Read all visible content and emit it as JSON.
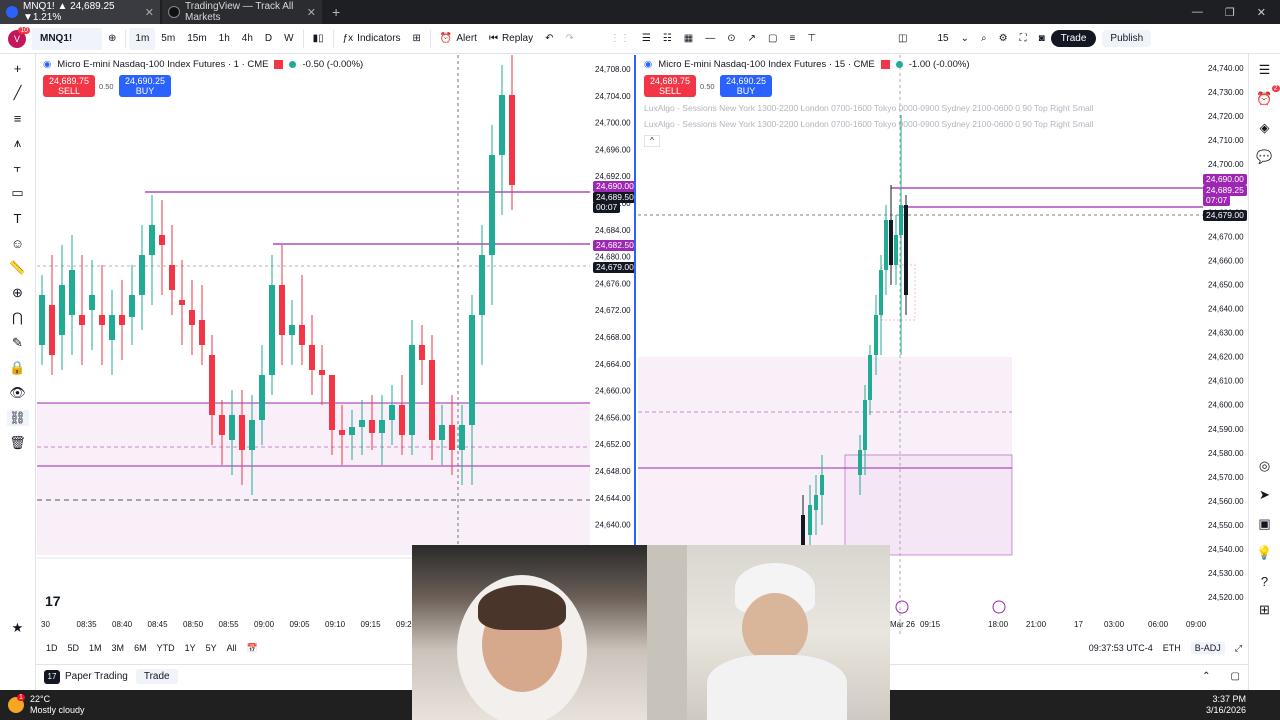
{
  "browser": {
    "tabs": [
      {
        "label": "MNQ1! ▲ 24,689.25 ▼1.21%",
        "active": true
      },
      {
        "label": "TradingView — Track All Markets",
        "active": false
      }
    ],
    "new_tab": "+"
  },
  "toolbar": {
    "symbol": "MNQ1!",
    "avatar_badge": "10",
    "intervals": [
      "1m",
      "5m",
      "15m",
      "1h",
      "4h",
      "D",
      "W"
    ],
    "active_interval": "1m",
    "indicators_label": "Indicators",
    "alert_label": "Alert",
    "replay_label": "Replay",
    "layout_count": "15",
    "trade_label": "Trade",
    "publish_label": "Publish"
  },
  "left_chart": {
    "legend_title": "Micro E-mini Nasdaq-100 Index Futures · 1 · CME",
    "legend_change": "-0.50 (-0.00%)",
    "sell_price": "24,689.75",
    "sell_label": "SELL",
    "spread": "0.50",
    "buy_price": "24,690.25",
    "buy_label": "BUY",
    "price_ticks": [
      "24,708.00",
      "24,704.00",
      "24,700.00",
      "24,696.00",
      "24,692.00",
      "24,688.00",
      "24,684.00",
      "24,680.00",
      "24,676.00",
      "24,672.00",
      "24,668.00",
      "24,664.00",
      "24,660.00",
      "24,656.00",
      "24,652.00",
      "24,648.00",
      "24,644.00",
      "24,640.00"
    ],
    "tag_line1": "24,690.00",
    "tag_current": "24,689.50",
    "tag_countdown": "00:07",
    "tag_line2": "24,682.50",
    "tag_cross": "24,679.00",
    "time_ticks": [
      "30",
      "08:35",
      "08:40",
      "08:45",
      "08:50",
      "08:55",
      "09:00",
      "09:05",
      "09:10",
      "09:15",
      "09:20"
    ]
  },
  "right_chart": {
    "legend_title": "Micro E-mini Nasdaq-100 Index Futures · 15 · CME",
    "legend_change": "-1.00 (-0.00%)",
    "sell_price": "24,689.75",
    "sell_label": "SELL",
    "spread": "0.50",
    "buy_price": "24,690.25",
    "buy_label": "BUY",
    "session_line1": "LuxAlgo - Sessions New York 1300-2200 London 0700-1600 Tokyo 0000-0900 Sydney 2100-0600 0 90 Top Right Small",
    "session_line2": "LuxAlgo - Sessions New York 1300-2200 London 0700-1600 Tokyo 0000-0900 Sydney 2100-0600 0 90 Top Right Small",
    "price_ticks": [
      "24,740.00",
      "24,730.00",
      "24,720.00",
      "24,710.00",
      "24,700.00",
      "24,690.00",
      "24,680.00",
      "24,670.00",
      "24,660.00",
      "24,650.00",
      "24,640.00",
      "24,630.00",
      "24,620.00",
      "24,610.00",
      "24,600.00",
      "24,590.00",
      "24,580.00",
      "24,570.00",
      "24,560.00",
      "24,550.00",
      "24,540.00",
      "24,530.00",
      "24,520.00"
    ],
    "tag_line1": "24,690.00",
    "tag_current": "24,689.25",
    "tag_countdown": "07:07",
    "tag_line2": "24,679.00",
    "time_ticks": [
      "Mar 26",
      "09:15",
      "18:00",
      "21:00",
      "17",
      "03:00",
      "06:00",
      "09:00"
    ]
  },
  "bottom": {
    "ranges": [
      "1D",
      "5D",
      "1M",
      "3M",
      "6M",
      "YTD",
      "1Y",
      "5Y",
      "All"
    ],
    "clock": "09:37:53 UTC-4",
    "session": "ETH",
    "adj": "B-ADJ",
    "paper_trading": "Paper Trading",
    "trade_tab": "Trade"
  },
  "taskbar": {
    "temp": "22°C",
    "weather": "Mostly cloudy",
    "weather_badge": "1",
    "time": "3:37 PM",
    "date": "3/16/2026"
  },
  "colors": {
    "up": "#22ab94",
    "down": "#f23645",
    "accent": "#2962ff",
    "level": "#9c27b0",
    "zone": "#f3e1f3"
  }
}
